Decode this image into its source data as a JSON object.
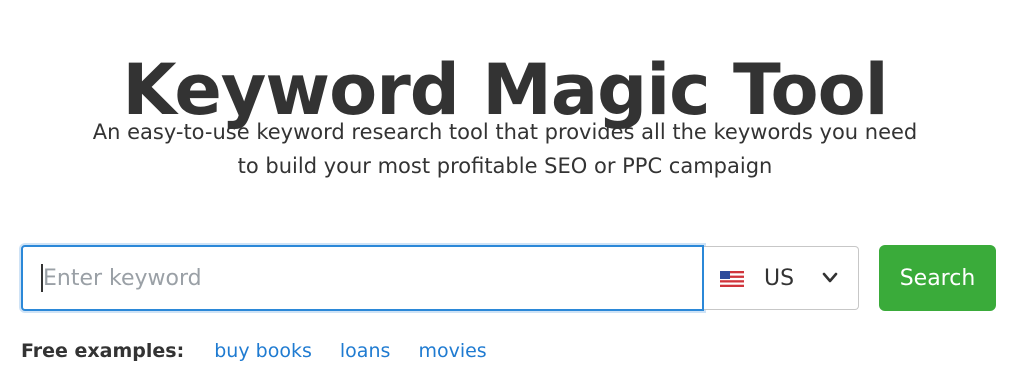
{
  "header": {
    "title": "Keyword Magic Tool",
    "subtitle_line1": "An easy-to-use keyword research tool that provides all the keywords you need",
    "subtitle_line2": "to build your most profitable SEO or PPC campaign"
  },
  "search": {
    "placeholder": "Enter keyword",
    "value": "",
    "country": {
      "flag_icon": "us-flag-icon",
      "code": "US",
      "chevron_icon": "chevron-down-icon"
    },
    "button_label": "Search"
  },
  "examples": {
    "label": "Free examples:",
    "items": [
      "buy books",
      "loans",
      "movies"
    ]
  },
  "colors": {
    "title_text": "#333333",
    "input_focus_border": "#2b88d8",
    "search_button": "#3aab3a",
    "link": "#1f7bd1"
  }
}
